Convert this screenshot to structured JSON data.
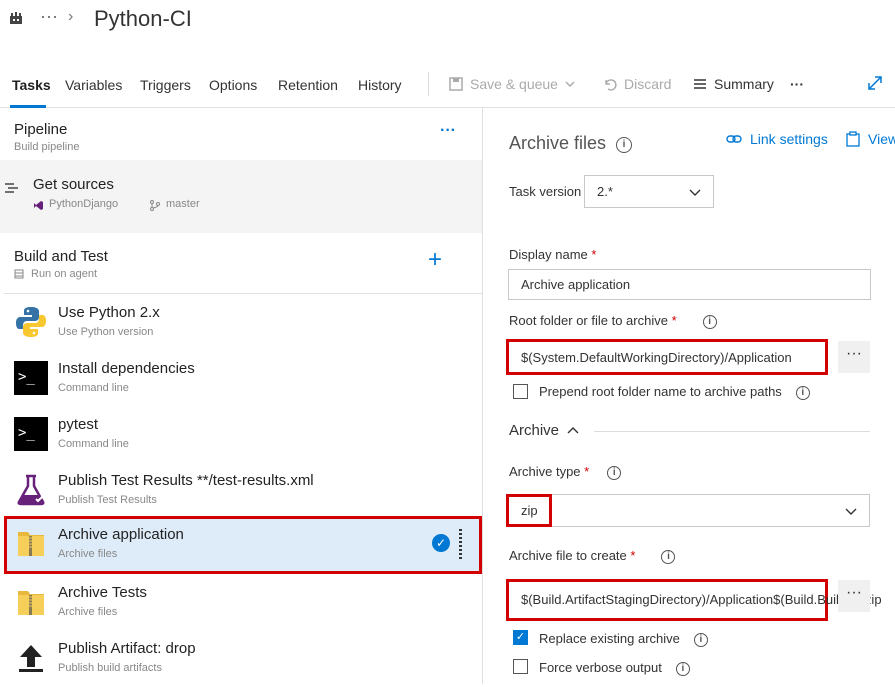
{
  "header": {
    "breadcrumb_dots": "···",
    "breadcrumb_chevron": "›",
    "title": "Python-CI"
  },
  "tabs": [
    {
      "label": "Tasks"
    },
    {
      "label": "Variables"
    },
    {
      "label": "Triggers"
    },
    {
      "label": "Options"
    },
    {
      "label": "Retention"
    },
    {
      "label": "History"
    }
  ],
  "toolbar": {
    "save_queue": "Save & queue",
    "discard": "Discard",
    "summary": "Summary",
    "more": "···"
  },
  "pipeline": {
    "title": "Pipeline",
    "subtitle": "Build pipeline",
    "more": "···"
  },
  "get_sources": {
    "title": "Get sources",
    "repo": "PythonDjango",
    "branch": "master"
  },
  "phase": {
    "title": "Build and Test",
    "subtitle": "Run on agent",
    "add": "+"
  },
  "tasks": [
    {
      "name": "Use Python 2.x",
      "sub": "Use Python version"
    },
    {
      "name": "Install dependencies",
      "sub": "Command line"
    },
    {
      "name": "pytest",
      "sub": "Command line"
    },
    {
      "name": "Publish Test Results **/test-results.xml",
      "sub": "Publish Test Results"
    },
    {
      "name": "Archive application",
      "sub": "Archive files"
    },
    {
      "name": "Archive Tests",
      "sub": "Archive files"
    },
    {
      "name": "Publish Artifact: drop",
      "sub": "Publish build artifacts"
    }
  ],
  "detail": {
    "title": "Archive files",
    "link_settings": "Link settings",
    "view": "View",
    "task_version_label": "Task version",
    "task_version_value": "2.*",
    "display_name_label": "Display name",
    "display_name_value": "Archive application",
    "root_folder_label": "Root folder or file to archive",
    "root_folder_value": "$(System.DefaultWorkingDirectory)/Application",
    "prepend_label": "Prepend root folder name to archive paths",
    "archive_section": "Archive",
    "archive_type_label": "Archive type",
    "archive_type_value": "zip",
    "archive_file_label": "Archive file to create",
    "archive_file_value": "$(Build.ArtifactStagingDirectory)/Application$(Build.BuildId).zip",
    "replace_label": "Replace existing archive",
    "verbose_label": "Force verbose output",
    "required_mark": "*",
    "ellipsis": "···"
  },
  "colors": {
    "accent": "#0078d4",
    "highlight_red": "#d20000",
    "selected_bg": "#deecf9"
  }
}
